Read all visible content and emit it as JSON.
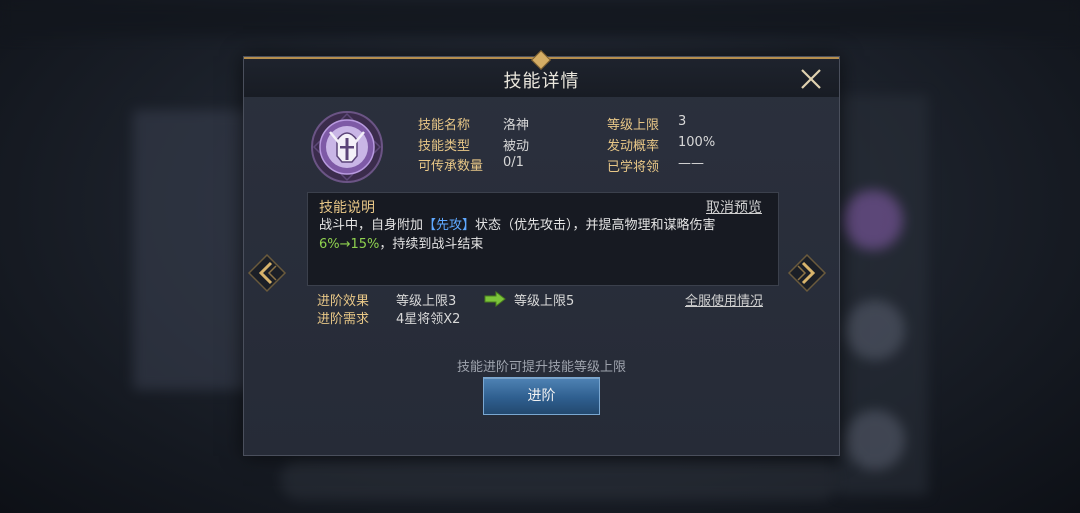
{
  "dialog": {
    "title": "技能详情"
  },
  "skill": {
    "info": {
      "name_label": "技能名称",
      "name_value": "洛神",
      "type_label": "技能类型",
      "type_value": "被动",
      "inherit_label": "可传承数量",
      "inherit_value": "0/1",
      "level_cap_label": "等级上限",
      "level_cap_value": "3",
      "trigger_rate_label": "发动概率",
      "trigger_rate_value": "100%",
      "learned_label": "已学将领",
      "learned_value": "——"
    },
    "description": {
      "title": "技能说明",
      "cancel_preview": "取消预览",
      "text_part1": "战斗中，自身附加",
      "text_highlight": "【先攻】",
      "text_part2": "状态（优先攻击），并提高物理和谋略伤害",
      "text_range": "6%→15%",
      "text_part3": "，持续到战斗结束"
    },
    "advance": {
      "effect_label": "进阶效果",
      "effect_from": "等级上限3",
      "effect_to": "等级上限5",
      "requirement_label": "进阶需求",
      "requirement_value": "4星将领X2",
      "server_usage": "全服使用情况",
      "hint": "技能进阶可提升技能等级上限",
      "button_label": "进阶"
    }
  },
  "colors": {
    "label_gold": "#e8c787",
    "highlight_blue": "#5fa8ff",
    "highlight_green": "#8fd14f",
    "skill_icon_purple": "#7e5aa6"
  },
  "icons": {
    "skill": "warrior-helmet-sword-icon",
    "close": "close-icon",
    "prev": "chevron-left-icon",
    "next": "chevron-right-icon",
    "arrow": "green-arrow-right-icon"
  }
}
